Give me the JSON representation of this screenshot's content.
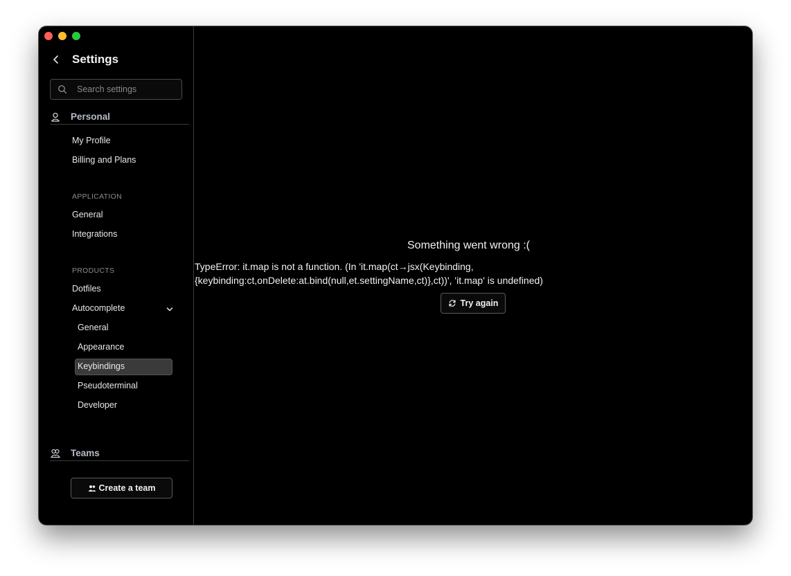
{
  "window": {
    "title": "Settings"
  },
  "search": {
    "placeholder": "Search settings"
  },
  "sections": {
    "personal": "Personal",
    "teams": "Teams"
  },
  "personal_items": [
    "My Profile",
    "Billing and Plans"
  ],
  "groups": {
    "application": "APPLICATION",
    "products": "PRODUCTS"
  },
  "application_items": [
    "General",
    "Integrations"
  ],
  "products_items": [
    "Dotfiles",
    "Autocomplete"
  ],
  "autocomplete_items": [
    "General",
    "Appearance",
    "Keybindings",
    "Pseudoterminal",
    "Developer"
  ],
  "selected_item": "Keybindings",
  "teams": {
    "create_label": "Create a team"
  },
  "error": {
    "title": "Something went wrong :(",
    "message": "TypeError: it.map is not a function. (In 'it.map(ct→jsx(Keybinding, {keybinding:ct,onDelete:at.bind(null,et.settingName,ct)},ct))', 'it.map' is undefined)",
    "retry_label": "Try again"
  },
  "icons": {
    "back": "chevron-left-icon",
    "search": "search-icon",
    "personal": "user-icon",
    "teams": "team-icon",
    "expand": "chevron-down-icon",
    "create_team": "people-icon",
    "retry": "refresh-icon"
  },
  "colors": {
    "background": "#000000",
    "section_label": "#b5bcc8",
    "selected_bg": "#3a3a3a",
    "close": "#ff5f57",
    "minimize": "#febc2e",
    "maximize": "#28c840"
  }
}
